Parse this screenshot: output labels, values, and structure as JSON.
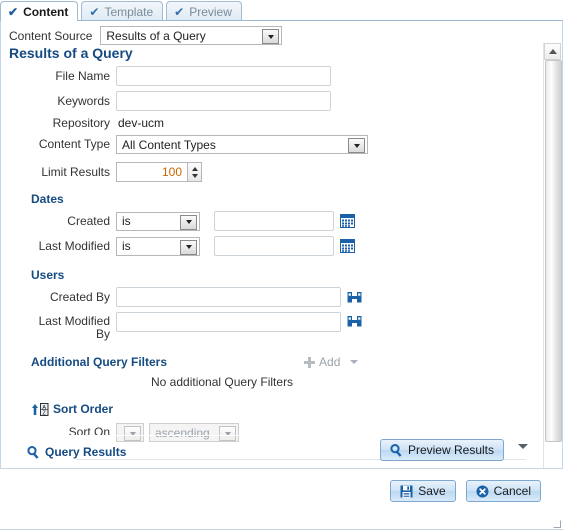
{
  "window": {
    "tabs": [
      {
        "label": "Content",
        "icon": "checkmark-icon",
        "active": true
      },
      {
        "label": "Template",
        "icon": "checkmark-icon",
        "active": false
      },
      {
        "label": "Preview",
        "icon": "checkmark-icon",
        "active": false
      }
    ]
  },
  "content_source": {
    "label": "Content Source",
    "value": "Results of a Query"
  },
  "form": {
    "heading": "Results of a Query",
    "file_name": {
      "label": "File Name",
      "value": "",
      "placeholder": ""
    },
    "keywords": {
      "label": "Keywords",
      "value": "",
      "placeholder": ""
    },
    "repository": {
      "label": "Repository",
      "value": "dev-ucm"
    },
    "content_type": {
      "label": "Content Type",
      "value": "All Content Types"
    },
    "limit_results": {
      "label": "Limit Results",
      "value": "100"
    }
  },
  "dates": {
    "heading": "Dates",
    "created": {
      "label": "Created",
      "operator": "is",
      "value": "",
      "calendar_icon": "calendar-icon"
    },
    "last_modified": {
      "label": "Last Modified",
      "operator": "is",
      "value": "",
      "calendar_icon": "calendar-icon"
    }
  },
  "users": {
    "heading": "Users",
    "created_by": {
      "label": "Created By",
      "value": "",
      "picker_icon": "binoculars-icon"
    },
    "last_modified_by": {
      "label": "Last Modified By",
      "label_line1": "Last Modified",
      "label_line2": "By",
      "value": "",
      "picker_icon": "binoculars-icon"
    }
  },
  "query_filters": {
    "heading": "Additional Query Filters",
    "add_label": "Add",
    "empty_message": "No additional Query Filters"
  },
  "sort_order": {
    "heading": "Sort Order",
    "icon": "sort-az-icon",
    "sort_on_label": "Sort On",
    "sort_on_value": "",
    "direction_value": "ascending"
  },
  "query_results": {
    "heading": "Query Results",
    "icon": "magnifier-icon",
    "preview_button": "Preview Results",
    "preview_icon": "magnifier-icon"
  },
  "footer": {
    "save": {
      "label": "Save",
      "icon": "save-disk-icon"
    },
    "cancel": {
      "label": "Cancel",
      "icon": "cancel-x-icon"
    }
  },
  "colors": {
    "accent_blue": "#154b82",
    "icon_blue": "#1b61a8",
    "tab_inactive_text": "#7a8a99",
    "number_value": "#cc6600"
  }
}
